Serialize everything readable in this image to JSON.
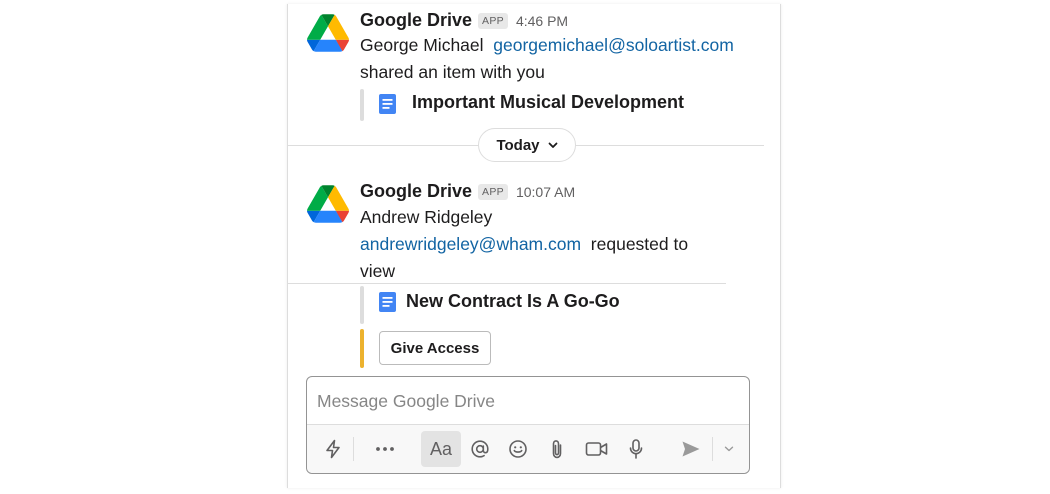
{
  "messages": [
    {
      "sender": "Google Drive",
      "badge": "APP",
      "time": "4:46 PM",
      "actor_name": "George Michael",
      "actor_email": "georgemichael@soloartist.com",
      "action_text": "shared an item with you",
      "document_title": "Important Musical Development"
    },
    {
      "sender": "Google Drive",
      "badge": "APP",
      "time": "10:07 AM",
      "actor_name": "Andrew Ridgeley",
      "actor_email": "andrewridgeley@wham.com",
      "action_text_line1": "requested to",
      "action_text_line2": "view",
      "document_title": "New Contract Is A Go-Go",
      "action_button": "Give Access"
    }
  ],
  "date_divider": {
    "label": "Today"
  },
  "composer": {
    "placeholder": "Message Google Drive",
    "toolbar": {
      "shortcuts_icon": "lightning-icon",
      "more_icon": "ellipsis-icon",
      "format_label": "Aa",
      "mention_icon": "at-icon",
      "emoji_icon": "smiley-icon",
      "attach_icon": "paperclip-icon",
      "video_icon": "video-camera-icon",
      "audio_icon": "microphone-icon",
      "send_icon": "send-icon",
      "send_options_icon": "chevron-down-icon"
    }
  },
  "colors": {
    "link": "#1264a3",
    "accent_bar": "#ecb22e",
    "doc_icon": "#4285f4"
  }
}
